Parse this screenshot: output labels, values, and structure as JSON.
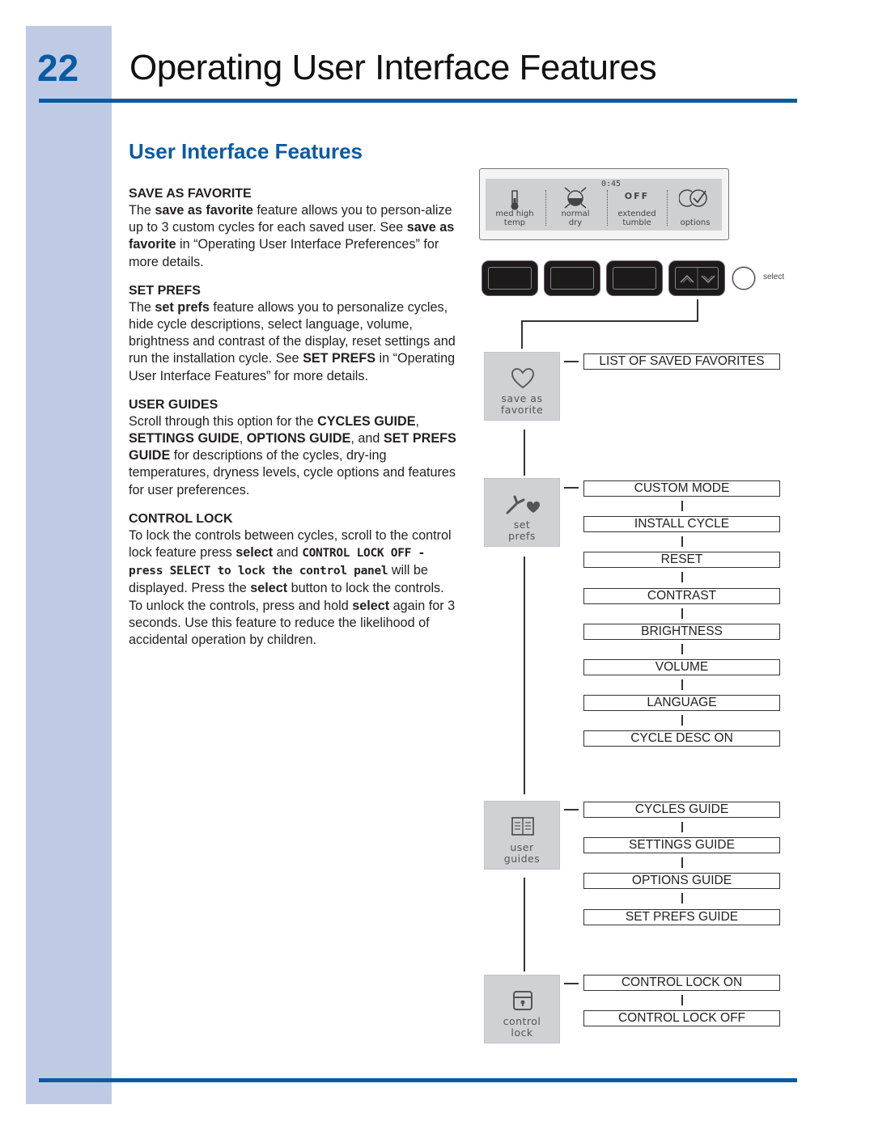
{
  "header": {
    "page_number": "22",
    "title": "Operating User Interface Features",
    "accent_color": "#0b5aa2",
    "sidebar_color": "#bfcbe4"
  },
  "section_title": "User Interface Features",
  "sections": {
    "save_as_favorite": {
      "heading": "SAVE AS FAVORITE",
      "p1_a": "The ",
      "p1_b": "save as favorite",
      "p1_c": " feature allows you to person-alize up to 3 custom cycles for each saved user. See ",
      "p1_d": "save as favorite",
      "p1_e": " in “Operating User Interface Preferences” for more details."
    },
    "set_prefs": {
      "heading": "SET PREFS",
      "p1_a": "The ",
      "p1_b": "set prefs",
      "p1_c": " feature allows you to personalize cycles, hide cycle descriptions, select language, volume, brightness and contrast of the display, reset settings and run the installation cycle. See ",
      "p1_d": "SET PREFS",
      "p1_e": " in “Operating User Interface Features” for more details."
    },
    "user_guides": {
      "heading": "USER GUIDES",
      "p1_a": "Scroll through this option for the ",
      "p1_b": "CYCLES GUIDE",
      "p1_c": ", ",
      "p1_d": "SETTINGS GUIDE",
      "p1_e": ", ",
      "p1_f": "OPTIONS GUIDE",
      "p1_g": ", and ",
      "p1_h": "SET PREFS GUIDE",
      "p1_i": " for descriptions of the cycles, dry-ing temperatures, dryness levels, cycle options and features for user preferences."
    },
    "control_lock": {
      "heading": "CONTROL LOCK",
      "p1_a": "To lock the controls between cycles, scroll to the control lock feature press ",
      "p1_b": "select",
      "p1_c": " and ",
      "p1_d": "CONTROL LOCK OFF - press SELECT to lock the control panel",
      "p1_e": " will be displayed. Press the ",
      "p1_f": "select",
      "p1_g": " button to lock the controls. To unlock the controls, press and hold ",
      "p1_h": "select",
      "p1_i": " again for 3 seconds. Use this feature to reduce the likelihood of accidental operation by children."
    }
  },
  "display": {
    "time": "0:45",
    "cells": [
      {
        "icon": "thermometer-icon",
        "label_1": "med high",
        "label_2": "temp"
      },
      {
        "icon": "dryness-icon",
        "label_1": "normal",
        "label_2": "dry"
      },
      {
        "icon": "off-text",
        "top_text": "OFF",
        "label_1": "extended",
        "label_2": "tumble"
      },
      {
        "icon": "options-check-icon",
        "label_1": "",
        "label_2": "options"
      }
    ]
  },
  "controls": {
    "buttons": [
      "button-1",
      "button-2",
      "button-3",
      "up-down-button"
    ],
    "select_label": "select"
  },
  "menus": [
    {
      "tile_label_1": "save as",
      "tile_label_2": "favorite",
      "icon": "heart-icon",
      "items": [
        "LIST OF SAVED FAVORITES"
      ]
    },
    {
      "tile_label_1": "set",
      "tile_label_2": "prefs",
      "icon": "wrench-heart-icon",
      "items": [
        "CUSTOM MODE",
        "INSTALL CYCLE",
        "RESET",
        "CONTRAST",
        "BRIGHTNESS",
        "VOLUME",
        "LANGUAGE",
        "CYCLE DESC ON"
      ]
    },
    {
      "tile_label_1": "user",
      "tile_label_2": "guides",
      "icon": "book-icon",
      "items": [
        "CYCLES GUIDE",
        "SETTINGS GUIDE",
        "OPTIONS GUIDE",
        "SET PREFS GUIDE"
      ]
    },
    {
      "tile_label_1": "control",
      "tile_label_2": "lock",
      "icon": "lock-icon",
      "items": [
        "CONTROL LOCK ON",
        "CONTROL LOCK OFF"
      ]
    }
  ]
}
